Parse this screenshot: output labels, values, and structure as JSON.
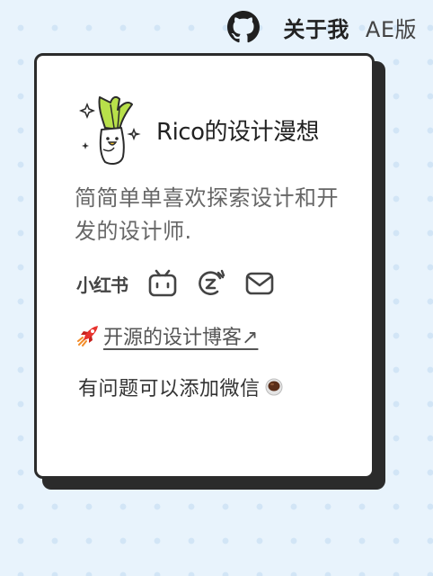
{
  "nav": {
    "github_icon": "github-icon",
    "about_label": "关于我",
    "ae_label": "AE版"
  },
  "profile": {
    "title": "Rico的设计漫想",
    "description": "简简单单喜欢探索设计和开发的设计师.",
    "mascot_icon": "leek-mascot"
  },
  "socials": {
    "xiaohongshu_label": "小红书",
    "icons": [
      "bilibili-icon",
      "zcool-icon",
      "mail-icon"
    ]
  },
  "blog": {
    "icon": "rocket-emoji",
    "label": "开源的设计博客↗"
  },
  "contact": {
    "label": "有问题可以添加微信",
    "icon": "coffee-emoji"
  },
  "colors": {
    "background": "#e8f3fc",
    "card": "#ffffff",
    "border": "#2b2b2b",
    "text_muted": "#666666"
  }
}
